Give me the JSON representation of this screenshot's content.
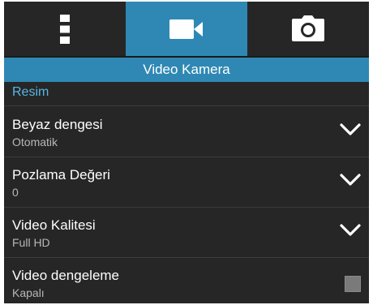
{
  "tabs": [
    {
      "icon": "more-vertical-icon",
      "active": false
    },
    {
      "icon": "video-camera-icon",
      "active": true
    },
    {
      "icon": "photo-camera-icon",
      "active": false
    }
  ],
  "header": {
    "title": "Video Kamera"
  },
  "section": {
    "title": "Resim"
  },
  "settings": [
    {
      "title": "Beyaz dengesi",
      "value": "Otomatik",
      "control": "dropdown"
    },
    {
      "title": "Pozlama Değeri",
      "value": "0",
      "control": "dropdown"
    },
    {
      "title": "Video Kalitesi",
      "value": "Full HD",
      "control": "dropdown"
    },
    {
      "title": "Video dengeleme",
      "value": "Kapalı",
      "control": "checkbox",
      "checked": false
    }
  ],
  "colors": {
    "accent": "#2f88b4",
    "section_text": "#57b6e6",
    "background": "#262626"
  }
}
